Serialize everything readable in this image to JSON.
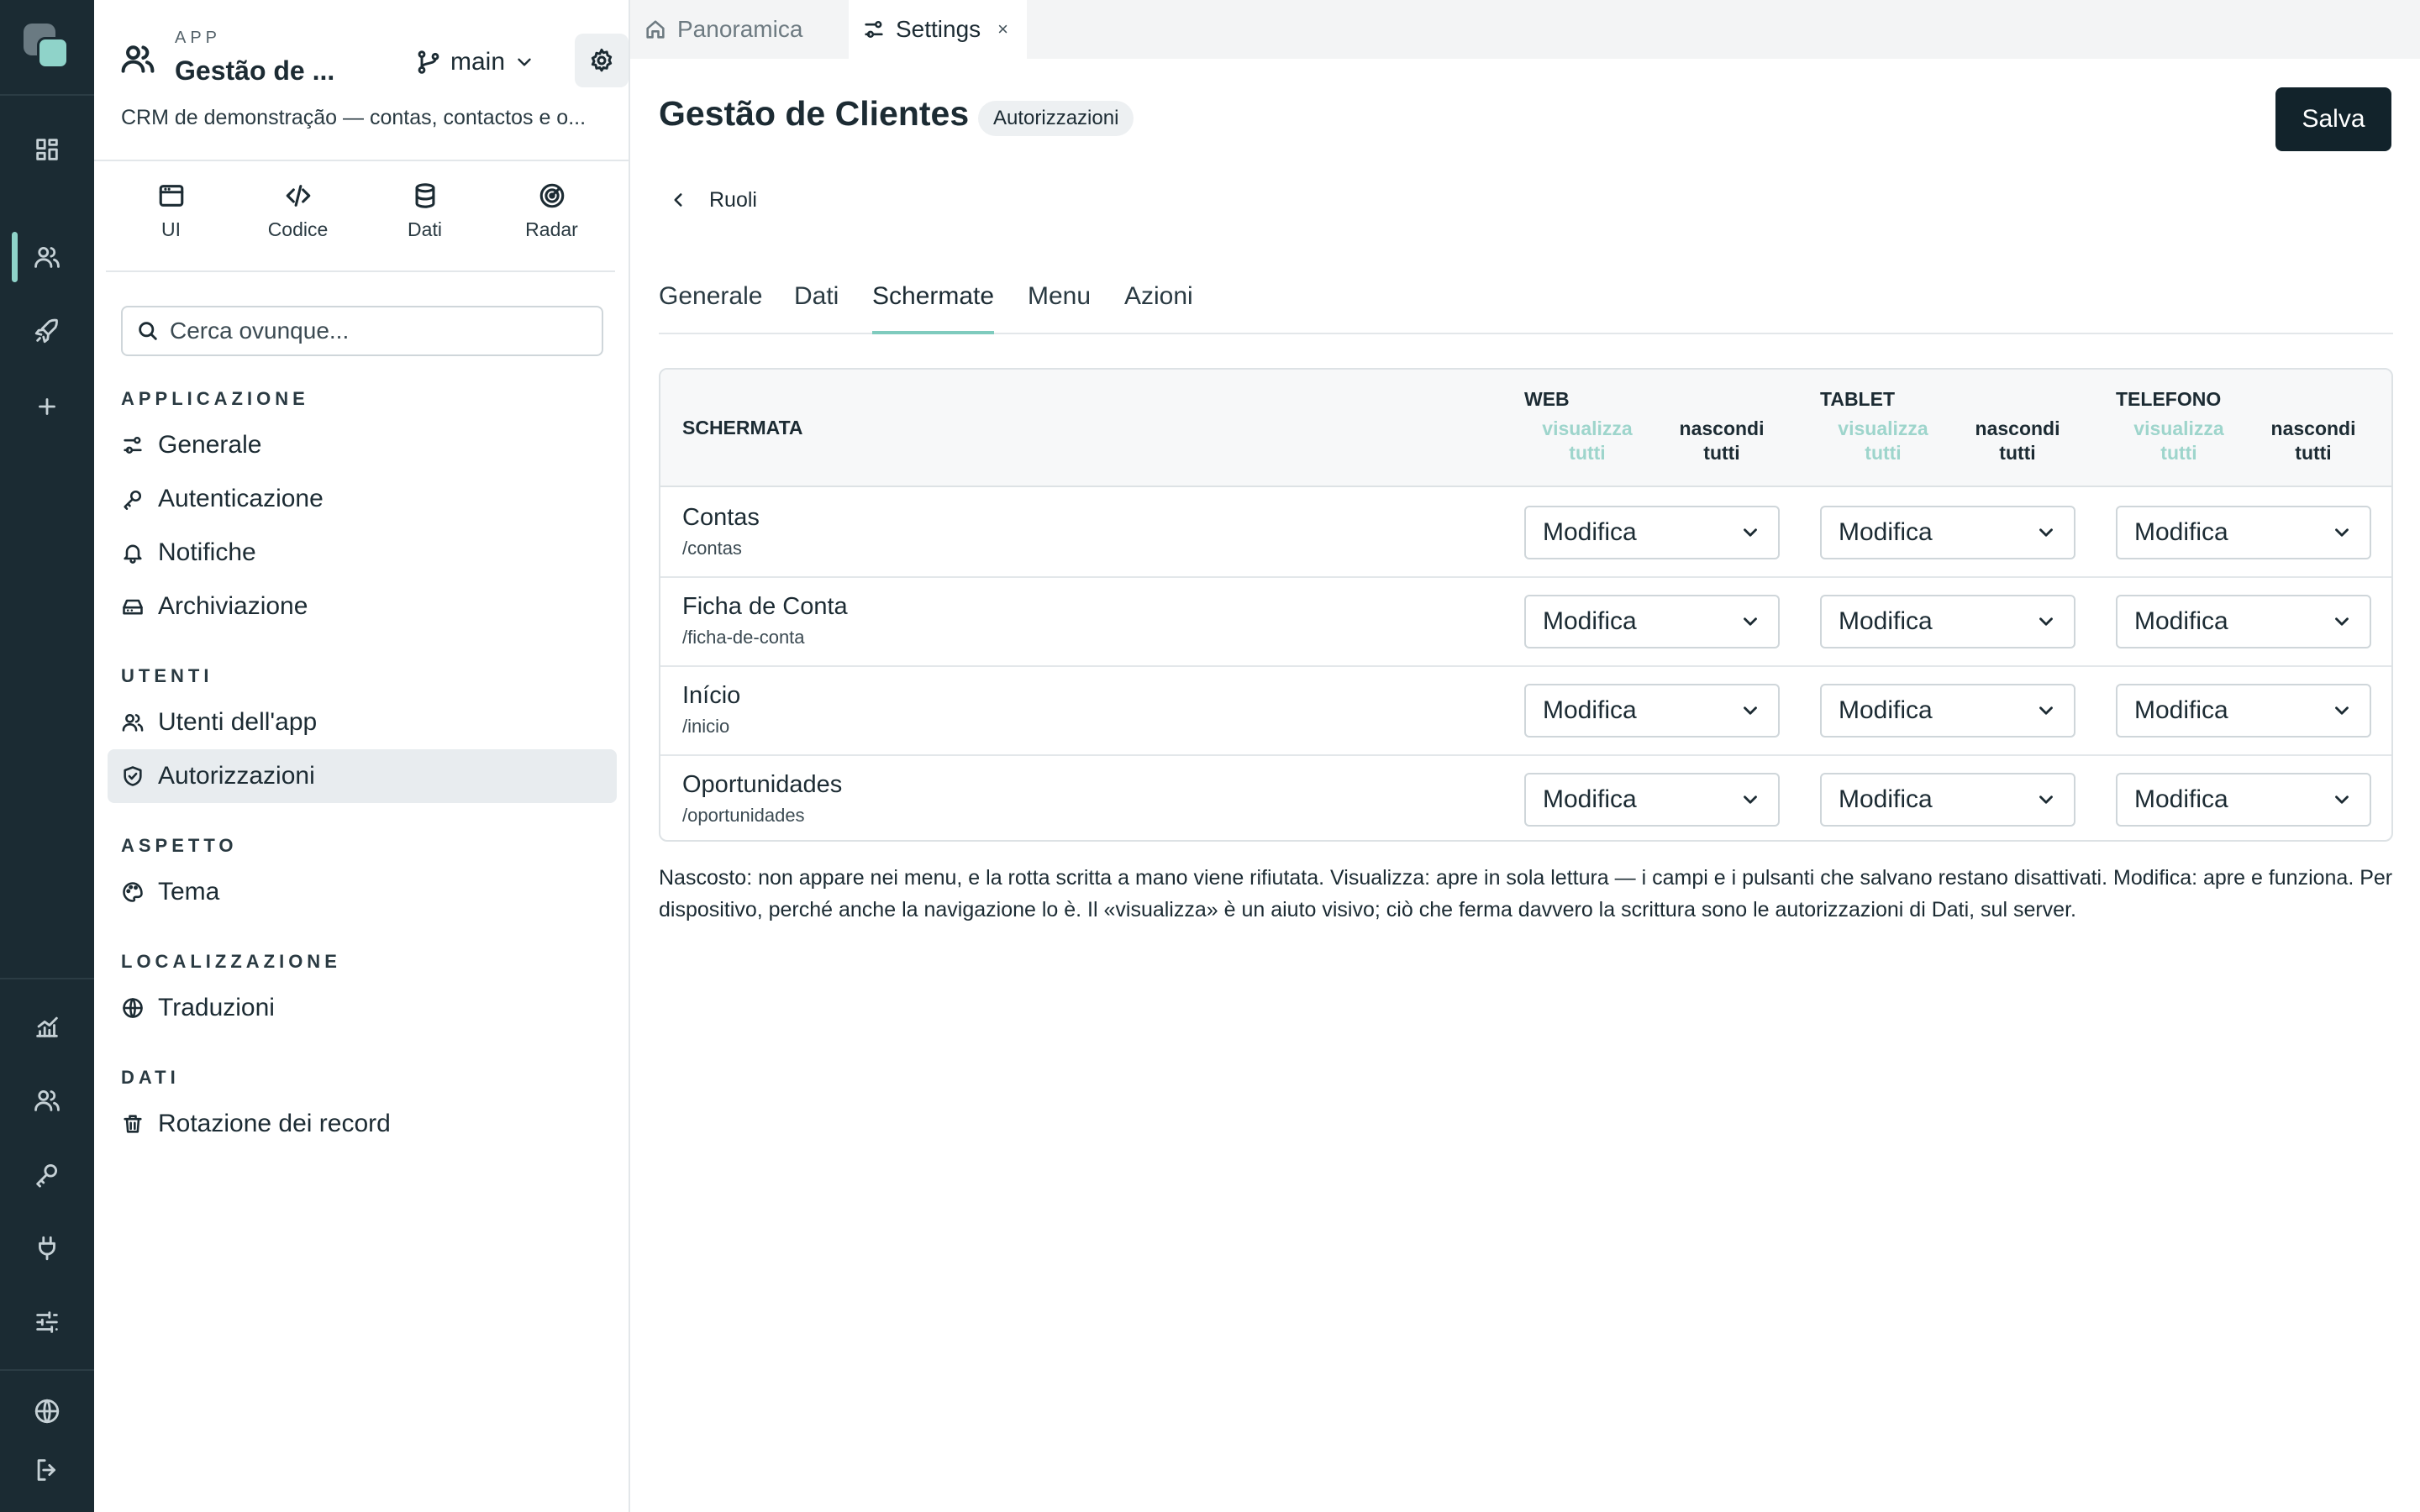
{
  "app": {
    "kicker": "APP",
    "name": "Gestão de ...",
    "branch": "main",
    "description": "CRM de demonstração — contas, contactos e o..."
  },
  "modes": [
    {
      "label": "UI",
      "icon": "browser-window-icon"
    },
    {
      "label": "Codice",
      "icon": "code-icon"
    },
    {
      "label": "Dati",
      "icon": "database-icon"
    },
    {
      "label": "Radar",
      "icon": "radar-icon"
    }
  ],
  "search": {
    "placeholder": "Cerca ovunque..."
  },
  "sidebar": {
    "sections": [
      {
        "title": "APPLICAZIONE",
        "items": [
          {
            "label": "Generale",
            "icon": "sliders-icon"
          },
          {
            "label": "Autenticazione",
            "icon": "key-icon"
          },
          {
            "label": "Notifiche",
            "icon": "bell-icon"
          },
          {
            "label": "Archiviazione",
            "icon": "hard-drive-icon"
          }
        ]
      },
      {
        "title": "UTENTI",
        "items": [
          {
            "label": "Utenti dell'app",
            "icon": "users-icon"
          },
          {
            "label": "Autorizzazioni",
            "icon": "shield-check-icon",
            "active": true
          }
        ]
      },
      {
        "title": "ASPETTO",
        "items": [
          {
            "label": "Tema",
            "icon": "palette-icon"
          }
        ]
      },
      {
        "title": "LOCALIZZAZIONE",
        "items": [
          {
            "label": "Traduzioni",
            "icon": "globe-icon"
          }
        ]
      },
      {
        "title": "DATI",
        "items": [
          {
            "label": "Rotazione dei record",
            "icon": "trash-icon"
          }
        ]
      }
    ]
  },
  "window_tabs": [
    {
      "label": "Panoramica",
      "icon": "home-icon",
      "active": false
    },
    {
      "label": "Settings",
      "icon": "sliders-icon",
      "active": true,
      "close": "×"
    }
  ],
  "page": {
    "title": "Gestão de Clientes",
    "badge": "Autorizzazioni",
    "save_label": "Salva",
    "back_label": "Ruoli"
  },
  "subtabs": [
    {
      "label": "Generale",
      "active": false
    },
    {
      "label": "Dati",
      "active": false
    },
    {
      "label": "Schermate",
      "active": true
    },
    {
      "label": "Menu",
      "active": false
    },
    {
      "label": "Azioni",
      "active": false
    }
  ],
  "table": {
    "screen_header": "SCHERMATA",
    "devices": [
      {
        "name": "WEB",
        "show_all": "visualizza tutti",
        "hide_all": "nascondi tutti"
      },
      {
        "name": "TABLET",
        "show_all": "visualizza tutti",
        "hide_all": "nascondi tutti"
      },
      {
        "name": "TELEFONO",
        "show_all": "visualizza tutti",
        "hide_all": "nascondi tutti"
      }
    ],
    "rows": [
      {
        "name": "Contas",
        "route": "/contas",
        "web": "Modifica",
        "tablet": "Modifica",
        "phone": "Modifica"
      },
      {
        "name": "Ficha de Conta",
        "route": "/ficha-de-conta",
        "web": "Modifica",
        "tablet": "Modifica",
        "phone": "Modifica"
      },
      {
        "name": "Início",
        "route": "/inicio",
        "web": "Modifica",
        "tablet": "Modifica",
        "phone": "Modifica"
      },
      {
        "name": "Oportunidades",
        "route": "/oportunidades",
        "web": "Modifica",
        "tablet": "Modifica",
        "phone": "Modifica"
      }
    ]
  },
  "note": "Nascosto: non appare nei menu, e la rotta scritta a mano viene rifiutata. Visualizza: apre in sola lettura — i campi e i pulsanti che salvano restano disattivati. Modifica: apre e funziona. Per dispositivo, perché anche la navigazione lo è. Il «visualizza» è un aiuto visivo; ciò che ferma davvero la scrittura sono le autorizzazioni di Dati, sul server.",
  "colors": {
    "rail_bg": "#1b2b33",
    "accent": "#8fd3c9",
    "primary_button": "#12232b"
  }
}
